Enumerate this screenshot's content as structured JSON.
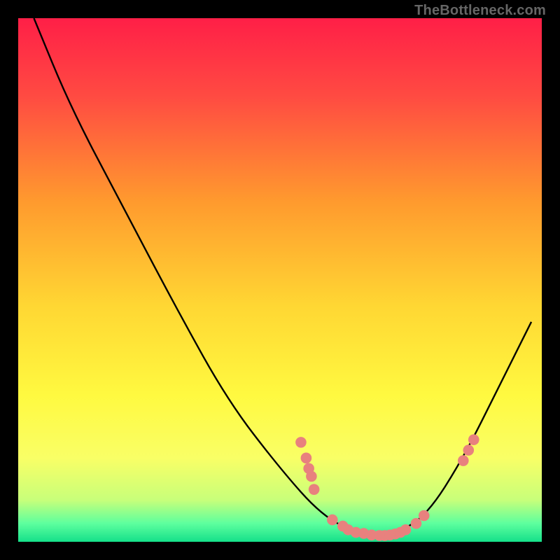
{
  "watermark": "TheBottleneck.com",
  "chart_data": {
    "type": "line",
    "title": "",
    "xlabel": "",
    "ylabel": "",
    "xlim": [
      0,
      100
    ],
    "ylim": [
      0,
      100
    ],
    "grid": false,
    "curve": [
      {
        "x": 3,
        "y": 100
      },
      {
        "x": 10,
        "y": 83
      },
      {
        "x": 20,
        "y": 64
      },
      {
        "x": 30,
        "y": 45
      },
      {
        "x": 40,
        "y": 27
      },
      {
        "x": 50,
        "y": 14
      },
      {
        "x": 58,
        "y": 5
      },
      {
        "x": 65,
        "y": 1.5
      },
      {
        "x": 72,
        "y": 1.5
      },
      {
        "x": 78,
        "y": 5
      },
      {
        "x": 85,
        "y": 16
      },
      {
        "x": 92,
        "y": 30
      },
      {
        "x": 98,
        "y": 42
      }
    ],
    "markers": [
      {
        "x": 54,
        "y": 19
      },
      {
        "x": 55,
        "y": 16
      },
      {
        "x": 55.5,
        "y": 14
      },
      {
        "x": 56,
        "y": 12.5
      },
      {
        "x": 56.5,
        "y": 10
      },
      {
        "x": 60,
        "y": 4.2
      },
      {
        "x": 62,
        "y": 3
      },
      {
        "x": 63,
        "y": 2.3
      },
      {
        "x": 64.5,
        "y": 1.8
      },
      {
        "x": 66,
        "y": 1.6
      },
      {
        "x": 67.5,
        "y": 1.3
      },
      {
        "x": 69,
        "y": 1.2
      },
      {
        "x": 70,
        "y": 1.2
      },
      {
        "x": 71,
        "y": 1.3
      },
      {
        "x": 72,
        "y": 1.5
      },
      {
        "x": 73,
        "y": 1.8
      },
      {
        "x": 74,
        "y": 2.3
      },
      {
        "x": 76,
        "y": 3.5
      },
      {
        "x": 77.5,
        "y": 5
      },
      {
        "x": 85,
        "y": 15.5
      },
      {
        "x": 86,
        "y": 17.5
      },
      {
        "x": 87,
        "y": 19.5
      }
    ],
    "background_gradient": {
      "type": "vertical",
      "stops": [
        {
          "pos": 0.0,
          "color": "#ff1f47"
        },
        {
          "pos": 0.15,
          "color": "#ff4b42"
        },
        {
          "pos": 0.35,
          "color": "#ff9a2e"
        },
        {
          "pos": 0.55,
          "color": "#ffd733"
        },
        {
          "pos": 0.72,
          "color": "#fff940"
        },
        {
          "pos": 0.84,
          "color": "#f9ff66"
        },
        {
          "pos": 0.92,
          "color": "#c8ff7a"
        },
        {
          "pos": 0.965,
          "color": "#5dff9e"
        },
        {
          "pos": 1.0,
          "color": "#15e08a"
        }
      ]
    },
    "marker_color": "#e8817e",
    "curve_color": "#000000",
    "border_color": "#000000"
  }
}
